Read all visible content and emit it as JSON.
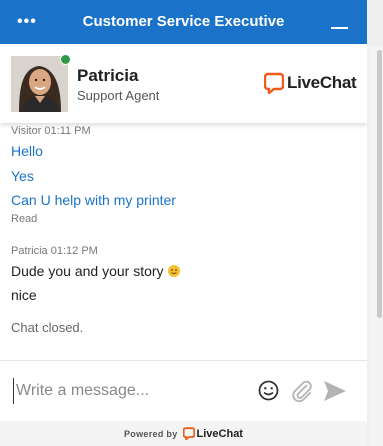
{
  "header": {
    "title": "Customer Service Executive",
    "menu_label": "•••"
  },
  "agent": {
    "name": "Patricia",
    "role": "Support Agent",
    "status": "online",
    "logo_text": "LiveChat"
  },
  "messages": {
    "visitor_meta": "Visitor 01:11 PM",
    "visitor_lines": [
      "Hello",
      "Yes",
      "Can U help with my printer"
    ],
    "read_receipt": "Read",
    "agent_meta": "Patricia 01:12 PM",
    "agent_lines": [
      "Dude you and your story",
      "nice"
    ]
  },
  "status_text": "Chat closed.",
  "composer": {
    "placeholder": "Write a message...",
    "value": ""
  },
  "footer": {
    "powered_by": "Powered by",
    "brand": "LiveChat"
  },
  "colors": {
    "header_bg": "#1a73c9",
    "visitor_text": "#1a73c9",
    "brand_orange": "#f05a1a",
    "online": "#2e9a48"
  },
  "icons": [
    "menu-dots-icon",
    "minimize-icon",
    "livechat-logo-icon",
    "emoji-icon",
    "attachment-icon",
    "send-icon"
  ]
}
